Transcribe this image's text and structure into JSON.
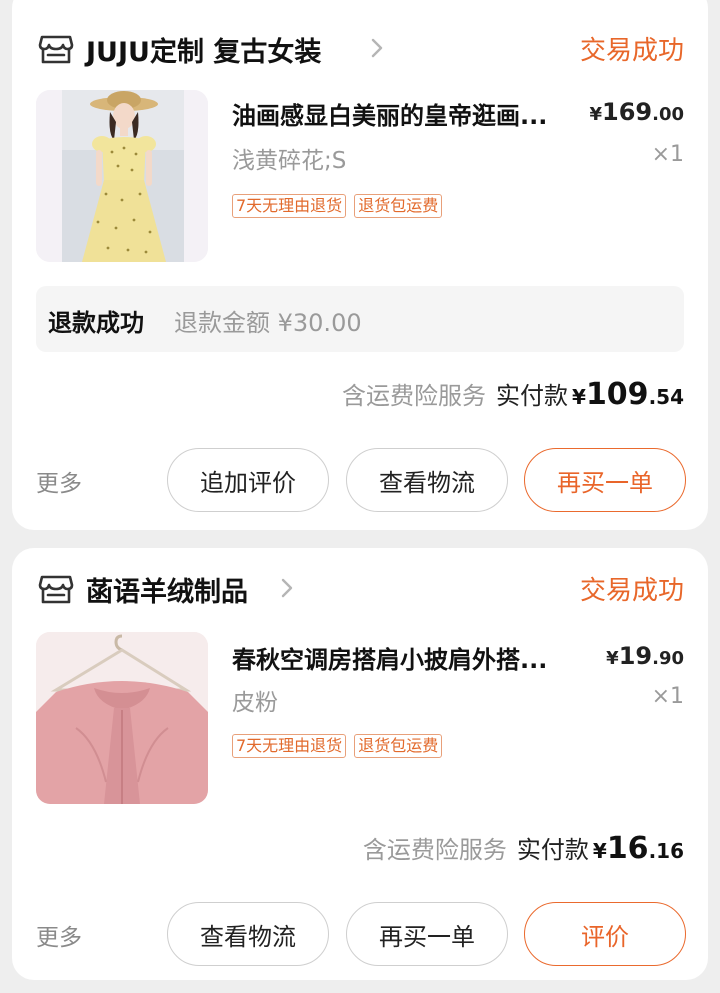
{
  "orders": [
    {
      "shop_name": "JUJU定制 复古女装",
      "status": "交易成功",
      "item": {
        "title": "油画感显白美丽的皇帝逛画...",
        "price_currency": "¥",
        "price_int": "169",
        "price_dec": ".00",
        "spec": "浅黄碎花;S",
        "qty": "×1",
        "tags": [
          "7天无理由退货",
          "退货包运费"
        ]
      },
      "refund": {
        "status": "退款成功",
        "amount_text": "退款金额 ¥30.00"
      },
      "total": {
        "insurance": "含运费险服务",
        "paid_label": "实付款",
        "currency": "¥",
        "int": "109",
        "dec": ".54"
      },
      "more": "更多",
      "buttons": [
        "追加评价",
        "查看物流",
        "再买一单"
      ]
    },
    {
      "shop_name": "菡语羊绒制品",
      "status": "交易成功",
      "item": {
        "title": "春秋空调房搭肩小披肩外搭...",
        "price_currency": "¥",
        "price_int": "19",
        "price_dec": ".90",
        "spec": "皮粉",
        "qty": "×1",
        "tags": [
          "7天无理由退货",
          "退货包运费"
        ]
      },
      "total": {
        "insurance": "含运费险服务",
        "paid_label": "实付款",
        "currency": "¥",
        "int": "16",
        "dec": ".16"
      },
      "more": "更多",
      "buttons": [
        "查看物流",
        "再买一单",
        "评价"
      ]
    }
  ],
  "colors": {
    "accent": "#e8672a",
    "muted": "#9a9a9a",
    "background": "#eeeeee"
  },
  "icons": [
    "store-icon",
    "chevron-right-icon"
  ]
}
